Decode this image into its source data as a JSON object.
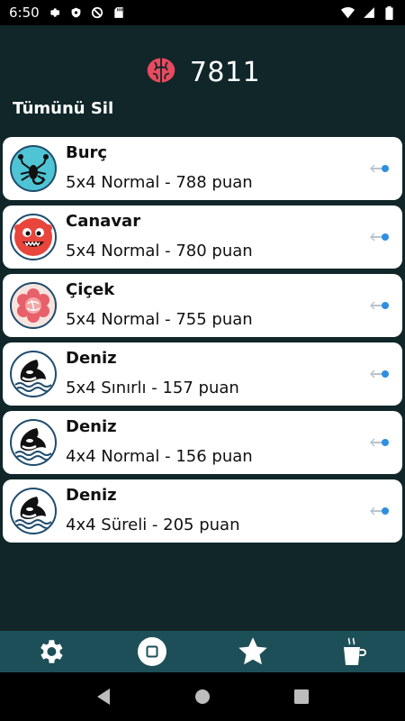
{
  "status": {
    "time": "6:50",
    "icons": [
      "gear-icon",
      "shield-icon",
      "no-sign-icon",
      "sd-card-icon",
      "wifi-icon",
      "signal-icon",
      "battery-icon"
    ]
  },
  "header": {
    "score": "7811",
    "icon": "brain-icon",
    "brand_color": "#e84a5f"
  },
  "clear_all_label": "Tümünü Sil",
  "records": [
    {
      "title": "Burç",
      "subtitle": "5x4 Normal - 788 puan",
      "avatar": "scorpion-icon",
      "avatar_bg": "#4fc4d4"
    },
    {
      "title": "Canavar",
      "subtitle": "5x4 Normal - 780 puan",
      "avatar": "monster-icon",
      "avatar_bg": "#e8453c"
    },
    {
      "title": "Çiçek",
      "subtitle": "5x4 Normal - 755 puan",
      "avatar": "flower-icon",
      "avatar_bg": "#f7e4df"
    },
    {
      "title": "Deniz",
      "subtitle": "5x4 Sınırlı - 157 puan",
      "avatar": "orca-icon",
      "avatar_bg": "#ffffff"
    },
    {
      "title": "Deniz",
      "subtitle": "4x4 Normal - 156 puan",
      "avatar": "orca-icon",
      "avatar_bg": "#ffffff"
    },
    {
      "title": "Deniz",
      "subtitle": "4x4 Süreli - 205 puan",
      "avatar": "orca-icon",
      "avatar_bg": "#ffffff"
    }
  ],
  "bottom_nav": [
    "settings-icon",
    "stop-icon",
    "star-icon",
    "coffee-icon"
  ],
  "colors": {
    "background": "#102629",
    "nav_bar": "#1d4f58",
    "card": "#ffffff",
    "toggle_accent": "#2f8fe0"
  }
}
